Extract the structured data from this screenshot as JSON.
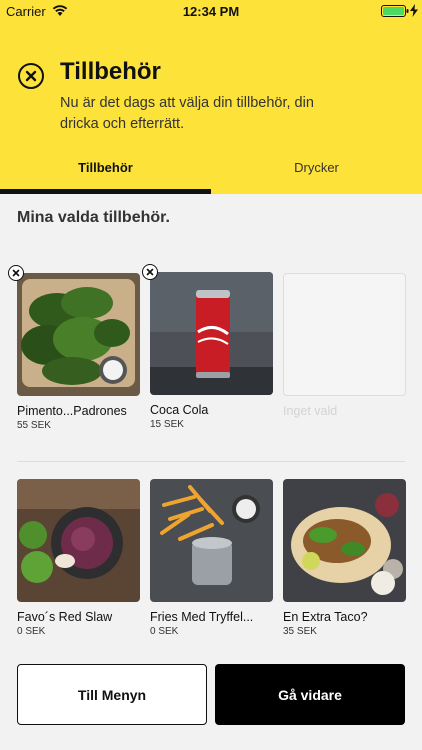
{
  "status_bar": {
    "carrier": "Carrier",
    "time": "12:34 PM"
  },
  "header": {
    "title": "Tillbehör",
    "subtitle": "Nu är det dags att välja din tillbehör, din dricka och efterrätt."
  },
  "tabs": [
    {
      "label": "Tillbehör",
      "active": true
    },
    {
      "label": "Drycker",
      "active": false
    }
  ],
  "selected_section": {
    "title": "Mina valda tillbehör."
  },
  "selected_items": [
    {
      "name": "Pimento...Padrones",
      "price": "55 SEK",
      "image": "padron-peppers-photo"
    },
    {
      "name": "Coca Cola",
      "price": "15 SEK",
      "image": "coca-cola-can-photo"
    },
    {
      "name": "Inget vald",
      "price": "",
      "image": "empty-slot"
    }
  ],
  "available_items": [
    {
      "name": "Favo´s Red Slaw",
      "price": "0 SEK",
      "image": "red-slaw-photo"
    },
    {
      "name": "Fries Med Tryffel...",
      "price": "0 SEK",
      "image": "truffle-fries-photo"
    },
    {
      "name": "En Extra Taco?",
      "price": "35 SEK",
      "image": "extra-taco-photo"
    }
  ],
  "buttons": {
    "back": "Till Menyn",
    "next": "Gå vidare"
  },
  "colors": {
    "header_bg": "#fde23a",
    "tab_indicator": "#111111",
    "battery": "#4cd964"
  }
}
